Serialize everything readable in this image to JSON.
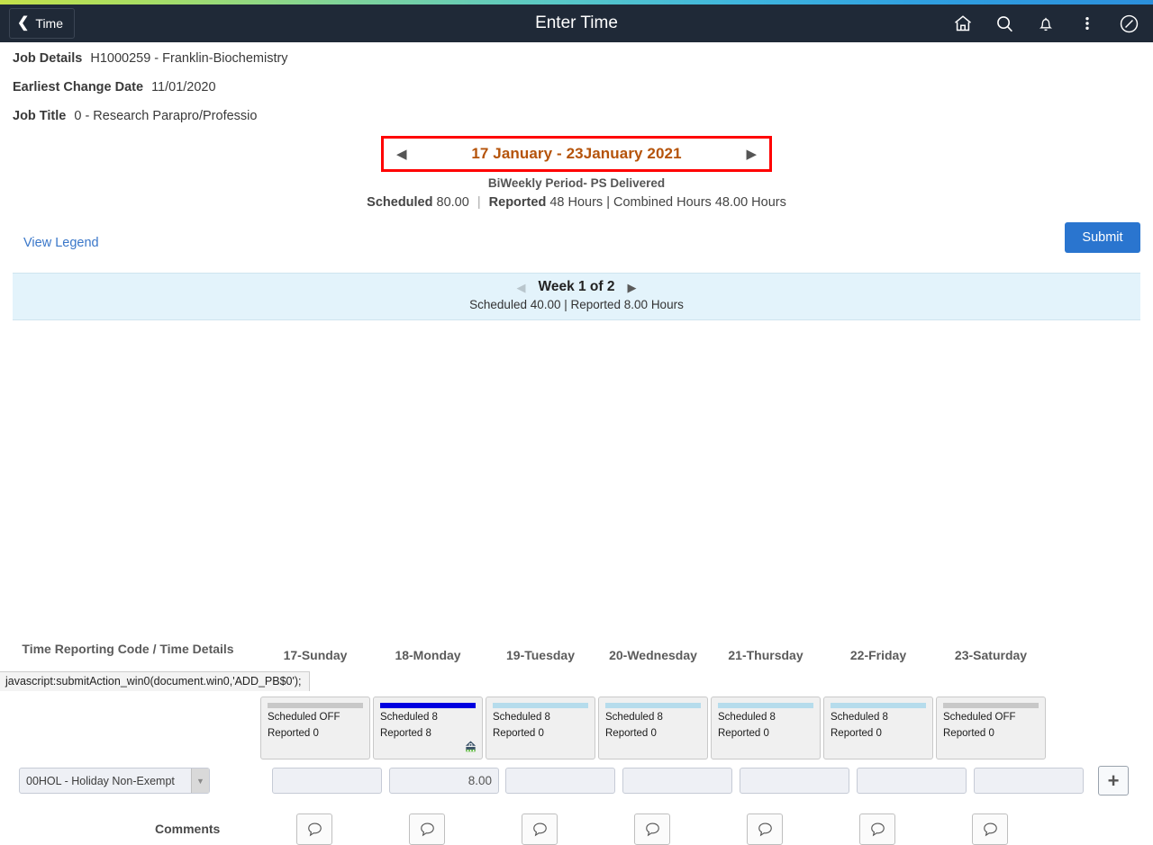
{
  "header": {
    "back_label": "Time",
    "title": "Enter Time",
    "icons": [
      "home-icon",
      "search-icon",
      "notifications-icon",
      "actions-menu-icon",
      "navbar-icon"
    ]
  },
  "job_info": [
    {
      "label": "Job Details",
      "value": "H1000259 - Franklin-Biochemistry"
    },
    {
      "label": "Earliest Change Date",
      "value": "11/01/2020"
    },
    {
      "label": "Job Title",
      "value": "0 - Research Parapro/Professio"
    }
  ],
  "period": {
    "prev_arrow": "◀",
    "next_arrow": "▶",
    "label": "17 January - 23January 2021",
    "subtitle": "BiWeekly Period- PS Delivered",
    "scheduled_label": "Scheduled",
    "scheduled_value": "80.00",
    "reported_label": "Reported",
    "reported_value": "48 Hours | Combined Hours",
    "combined_value": "48.00 Hours",
    "highlight_color": "#ff0000",
    "text_color": "#b5530a"
  },
  "actions": {
    "view_legend": "View Legend",
    "submit": "Submit",
    "submit_color": "#2a75cf"
  },
  "week": {
    "prev_arrow": "◀",
    "next_arrow": "▶",
    "title": "Week 1 of 2",
    "totals": "Scheduled  40.00 | Reported  8.00 Hours",
    "background": "#e3f3fb"
  },
  "grid": {
    "row_header": "Time Reporting Code / Time Details",
    "comments_label": "Comments",
    "add_row_icon": "plus-icon",
    "trc": {
      "value": "00HOL - Holiday Non-Exempt",
      "caret": "⌄"
    },
    "days": [
      {
        "header": "17-Sunday",
        "scheduled": "Scheduled OFF",
        "reported": "Reported   0",
        "bar_color": "#c8c8c8",
        "hours": "",
        "holiday_icon": false
      },
      {
        "header": "18-Monday",
        "scheduled": "Scheduled 8",
        "reported": "Reported   8",
        "bar_color": "#0000e0",
        "hours": "8.00",
        "holiday_icon": true
      },
      {
        "header": "19-Tuesday",
        "scheduled": "Scheduled 8",
        "reported": "Reported   0",
        "bar_color": "#b6dcec",
        "hours": "",
        "holiday_icon": false
      },
      {
        "header": "20-Wednesday",
        "scheduled": "Scheduled 8",
        "reported": "Reported   0",
        "bar_color": "#b6dcec",
        "hours": "",
        "holiday_icon": false
      },
      {
        "header": "21-Thursday",
        "scheduled": "Scheduled 8",
        "reported": "Reported   0",
        "bar_color": "#b6dcec",
        "hours": "",
        "holiday_icon": false
      },
      {
        "header": "22-Friday",
        "scheduled": "Scheduled 8",
        "reported": "Reported   0",
        "bar_color": "#b6dcec",
        "hours": "",
        "holiday_icon": false
      },
      {
        "header": "23-Saturday",
        "scheduled": "Scheduled OFF",
        "reported": "Reported   0",
        "bar_color": "#c8c8c8",
        "hours": "",
        "holiday_icon": false
      }
    ]
  },
  "status_bar": {
    "text": "javascript:submitAction_win0(document.win0,'ADD_PB$0');"
  }
}
